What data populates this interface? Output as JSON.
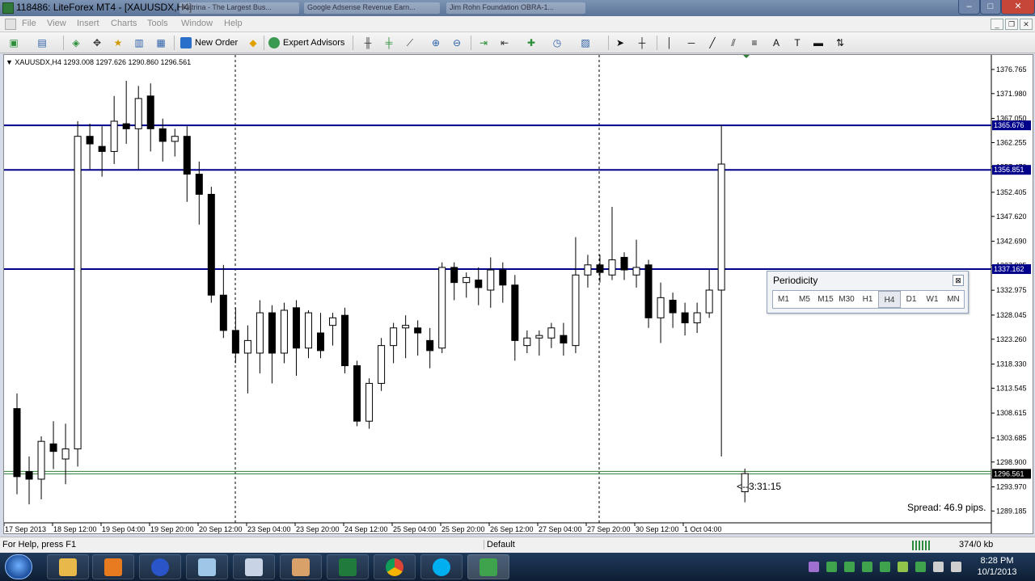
{
  "window": {
    "title": "118486: LiteForex MT4 - [XAUUSDX,H4]",
    "ghost_tabs": [
      "Katrina - The Largest Bus...",
      "Google Adsense Revenue Earn...",
      "Jim Rohn Foundation OBRA-1..."
    ]
  },
  "window_buttons": [
    "–",
    "□",
    "✕"
  ],
  "menu": [
    "File",
    "View",
    "Insert",
    "Charts",
    "Tools",
    "Window",
    "Help"
  ],
  "mdi_buttons": [
    "_",
    "❐",
    "✕"
  ],
  "toolbar": {
    "new_order": "New Order",
    "expert_advisors": "Expert Advisors"
  },
  "chart": {
    "symbol_info": "XAUUSDX,H4  1293.008 1297.626 1290.860 1296.561",
    "price_labels": [
      "1376.765",
      "1371.980",
      "1367.050",
      "1362.255",
      "1357.470",
      "1352.405",
      "1347.620",
      "1342.690",
      "1337.905",
      "1332.975",
      "1328.045",
      "1323.260",
      "1318.330",
      "1313.545",
      "1308.615",
      "1303.685",
      "1298.900",
      "1293.970",
      "1289.185"
    ],
    "hlines": [
      {
        "price": "1365.676",
        "color": "#00008b"
      },
      {
        "price": "1356.851",
        "color": "#00008b"
      },
      {
        "price": "1337.162",
        "color": "#00008b"
      }
    ],
    "bid_line": "1296.561",
    "time_labels": [
      "17 Sep 2013",
      "18 Sep 12:00",
      "19 Sep 04:00",
      "19 Sep 20:00",
      "20 Sep 12:00",
      "23 Sep 04:00",
      "23 Sep 20:00",
      "24 Sep 12:00",
      "25 Sep 04:00",
      "25 Sep 20:00",
      "26 Sep 12:00",
      "27 Sep 04:00",
      "27 Sep 20:00",
      "30 Sep 12:00",
      "1 Oct 04:00"
    ],
    "timer": "<--3:31:15",
    "spread": "Spread: 46.9 pips."
  },
  "periodicity": {
    "title": "Periodicity",
    "buttons": [
      "M1",
      "M5",
      "M15",
      "M30",
      "H1",
      "H4",
      "D1",
      "W1",
      "MN"
    ],
    "active": "H4",
    "close": "⊠"
  },
  "chart_data": {
    "type": "candlestick",
    "title": "XAUUSDX,H4",
    "ylim": [
      1287.0,
      1379.0
    ],
    "candles": [
      {
        "o": 1309.5,
        "h": 1312.5,
        "l": 1292.5,
        "c": 1296.0
      },
      {
        "o": 1297.0,
        "h": 1300.0,
        "l": 1290.5,
        "c": 1295.5
      },
      {
        "o": 1295.5,
        "h": 1304.0,
        "l": 1291.5,
        "c": 1303.0
      },
      {
        "o": 1302.5,
        "h": 1307.0,
        "l": 1297.5,
        "c": 1301.0
      },
      {
        "o": 1299.5,
        "h": 1306.5,
        "l": 1294.5,
        "c": 1301.5
      },
      {
        "o": 1301.5,
        "h": 1366.5,
        "l": 1298.0,
        "c": 1363.5
      },
      {
        "o": 1363.5,
        "h": 1366.0,
        "l": 1357.0,
        "c": 1362.0
      },
      {
        "o": 1361.5,
        "h": 1365.5,
        "l": 1355.5,
        "c": 1360.5
      },
      {
        "o": 1360.5,
        "h": 1371.5,
        "l": 1358.0,
        "c": 1366.5
      },
      {
        "o": 1366.0,
        "h": 1374.5,
        "l": 1362.0,
        "c": 1365.0
      },
      {
        "o": 1365.0,
        "h": 1373.5,
        "l": 1357.0,
        "c": 1371.0
      },
      {
        "o": 1371.5,
        "h": 1374.0,
        "l": 1360.5,
        "c": 1365.0
      },
      {
        "o": 1365.0,
        "h": 1367.0,
        "l": 1358.5,
        "c": 1362.5
      },
      {
        "o": 1362.5,
        "h": 1365.0,
        "l": 1359.5,
        "c": 1363.5
      },
      {
        "o": 1363.5,
        "h": 1365.5,
        "l": 1350.5,
        "c": 1356.0
      },
      {
        "o": 1356.0,
        "h": 1358.5,
        "l": 1346.0,
        "c": 1352.0
      },
      {
        "o": 1352.0,
        "h": 1353.5,
        "l": 1330.5,
        "c": 1332.0
      },
      {
        "o": 1332.0,
        "h": 1338.0,
        "l": 1323.5,
        "c": 1325.0
      },
      {
        "o": 1325.0,
        "h": 1329.5,
        "l": 1318.5,
        "c": 1320.5
      },
      {
        "o": 1320.5,
        "h": 1326.0,
        "l": 1312.5,
        "c": 1323.0
      },
      {
        "o": 1320.5,
        "h": 1331.0,
        "l": 1316.5,
        "c": 1328.5
      },
      {
        "o": 1328.5,
        "h": 1330.0,
        "l": 1314.5,
        "c": 1320.5
      },
      {
        "o": 1320.5,
        "h": 1330.5,
        "l": 1318.5,
        "c": 1329.0
      },
      {
        "o": 1329.5,
        "h": 1331.0,
        "l": 1316.0,
        "c": 1321.5
      },
      {
        "o": 1321.5,
        "h": 1329.0,
        "l": 1319.5,
        "c": 1328.5
      },
      {
        "o": 1324.5,
        "h": 1328.5,
        "l": 1319.5,
        "c": 1321.0
      },
      {
        "o": 1326.0,
        "h": 1328.5,
        "l": 1322.0,
        "c": 1327.5
      },
      {
        "o": 1328.0,
        "h": 1329.5,
        "l": 1316.5,
        "c": 1318.0
      },
      {
        "o": 1318.0,
        "h": 1319.0,
        "l": 1306.0,
        "c": 1307.0
      },
      {
        "o": 1307.0,
        "h": 1315.5,
        "l": 1305.5,
        "c": 1314.5
      },
      {
        "o": 1314.5,
        "h": 1323.5,
        "l": 1313.0,
        "c": 1322.0
      },
      {
        "o": 1322.0,
        "h": 1326.5,
        "l": 1318.5,
        "c": 1325.5
      },
      {
        "o": 1325.5,
        "h": 1328.0,
        "l": 1319.5,
        "c": 1326.0
      },
      {
        "o": 1325.5,
        "h": 1327.0,
        "l": 1320.0,
        "c": 1324.5
      },
      {
        "o": 1323.0,
        "h": 1325.5,
        "l": 1317.5,
        "c": 1321.0
      },
      {
        "o": 1321.5,
        "h": 1338.5,
        "l": 1320.5,
        "c": 1337.5
      },
      {
        "o": 1337.5,
        "h": 1338.5,
        "l": 1331.0,
        "c": 1334.5
      },
      {
        "o": 1334.5,
        "h": 1336.5,
        "l": 1331.5,
        "c": 1335.5
      },
      {
        "o": 1335.0,
        "h": 1337.5,
        "l": 1330.0,
        "c": 1333.5
      },
      {
        "o": 1333.0,
        "h": 1339.5,
        "l": 1329.5,
        "c": 1337.0
      },
      {
        "o": 1337.0,
        "h": 1338.5,
        "l": 1330.5,
        "c": 1334.0
      },
      {
        "o": 1334.0,
        "h": 1336.0,
        "l": 1319.0,
        "c": 1323.0
      },
      {
        "o": 1322.0,
        "h": 1325.0,
        "l": 1320.5,
        "c": 1323.5
      },
      {
        "o": 1323.5,
        "h": 1325.0,
        "l": 1320.0,
        "c": 1324.0
      },
      {
        "o": 1323.5,
        "h": 1326.5,
        "l": 1321.5,
        "c": 1325.5
      },
      {
        "o": 1324.0,
        "h": 1326.5,
        "l": 1320.0,
        "c": 1322.5
      },
      {
        "o": 1322.0,
        "h": 1343.5,
        "l": 1320.5,
        "c": 1336.0
      },
      {
        "o": 1336.0,
        "h": 1340.0,
        "l": 1333.5,
        "c": 1338.0
      },
      {
        "o": 1338.0,
        "h": 1340.0,
        "l": 1334.5,
        "c": 1336.5
      },
      {
        "o": 1336.0,
        "h": 1349.5,
        "l": 1335.0,
        "c": 1339.0
      },
      {
        "o": 1339.5,
        "h": 1340.5,
        "l": 1335.0,
        "c": 1337.0
      },
      {
        "o": 1336.0,
        "h": 1343.0,
        "l": 1333.5,
        "c": 1337.5
      },
      {
        "o": 1338.0,
        "h": 1339.0,
        "l": 1325.5,
        "c": 1327.5
      },
      {
        "o": 1327.5,
        "h": 1334.5,
        "l": 1322.5,
        "c": 1331.5
      },
      {
        "o": 1331.0,
        "h": 1332.5,
        "l": 1325.5,
        "c": 1328.5
      },
      {
        "o": 1328.5,
        "h": 1330.5,
        "l": 1324.0,
        "c": 1326.5
      },
      {
        "o": 1326.5,
        "h": 1330.5,
        "l": 1324.5,
        "c": 1328.5
      },
      {
        "o": 1328.5,
        "h": 1337.0,
        "l": 1327.5,
        "c": 1333.0
      },
      {
        "o": 1333.0,
        "h": 1365.7,
        "l": 1300.0,
        "c": 1358.0
      },
      {
        "o": 1293.0,
        "h": 1297.6,
        "l": 1290.9,
        "c": 1296.6
      }
    ]
  }
}
